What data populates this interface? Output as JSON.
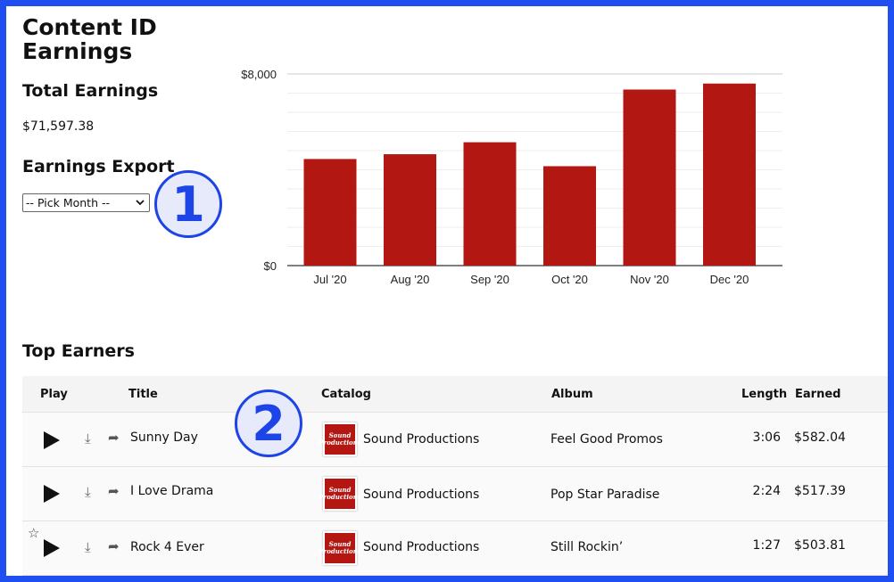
{
  "page": {
    "title": "Content ID Earnings"
  },
  "total": {
    "label": "Total Earnings",
    "value": "$71,597.38"
  },
  "export": {
    "label": "Earnings Export",
    "select_value": "-- Pick Month --"
  },
  "badges": {
    "one": "1",
    "two": "2"
  },
  "chart_data": {
    "type": "bar",
    "categories": [
      "Jul '20",
      "Aug '20",
      "Sep '20",
      "Oct '20",
      "Nov '20",
      "Dec '20"
    ],
    "values": [
      4450,
      4650,
      5150,
      4150,
      7350,
      7600
    ],
    "ylim": [
      0,
      8000
    ],
    "ytick_labels": [
      "$0",
      "$8,000"
    ],
    "grid": true,
    "bar_color": "#b31712"
  },
  "top_earners": {
    "label": "Top Earners",
    "headers": {
      "play": "Play",
      "title": "Title",
      "catalog": "Catalog",
      "album": "Album",
      "length": "Length",
      "earned": "Earned"
    },
    "rows": [
      {
        "title": "Sunny Day",
        "catalog": "Sound Productions",
        "album": "Feel Good Promos",
        "length": "3:06",
        "earned": "$582.04"
      },
      {
        "title": "I Love Drama",
        "catalog": "Sound Productions",
        "album": "Pop Star Paradise",
        "length": "2:24",
        "earned": "$517.39"
      },
      {
        "title": "Rock 4 Ever",
        "catalog": "Sound Productions",
        "album": "Still Rockin’",
        "length": "1:27",
        "earned": "$503.81"
      }
    ],
    "thumb_text": [
      "Sound",
      "Productions"
    ]
  },
  "icons": {
    "play": "play-icon",
    "download": "download-icon",
    "share": "share-icon",
    "star": "star-icon",
    "caret": "chevron-down-icon"
  }
}
